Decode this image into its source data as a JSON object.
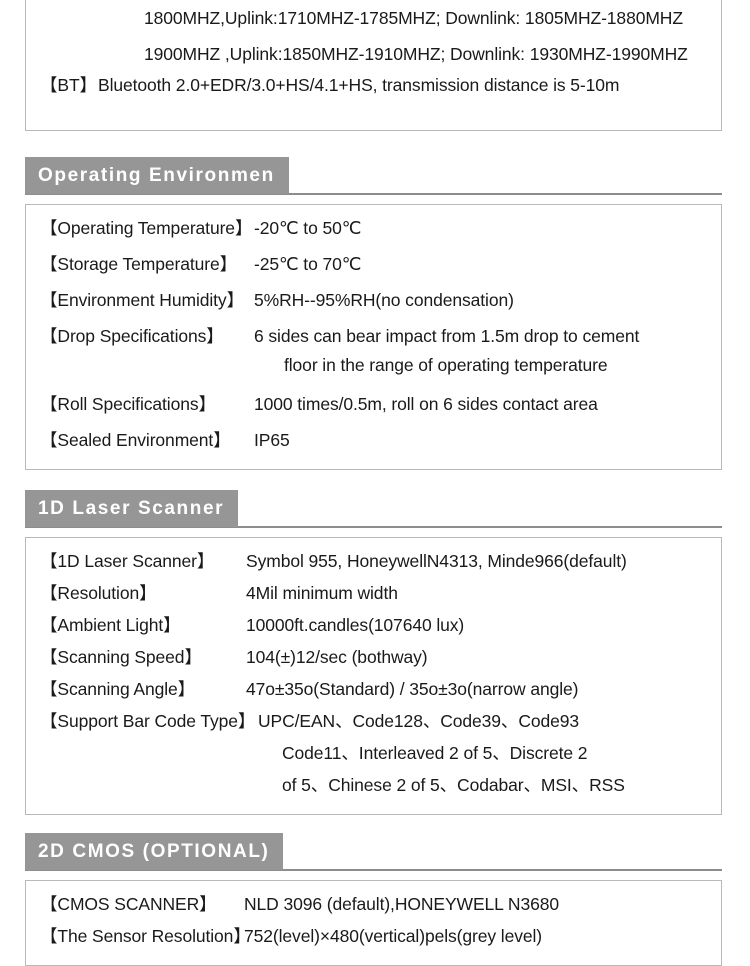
{
  "top_fragment": {
    "lines": [
      "1800MHZ,Uplink:1710MHZ-1785MHZ;  Downlink: 1805MHZ-1880MHZ",
      "1900MHZ ,Uplink:1850MHZ-1910MHZ;  Downlink: 1930MHZ-1990MHZ"
    ],
    "bt_label": "【BT】",
    "bt_value": "Bluetooth 2.0+EDR/3.0+HS/4.1+HS, transmission distance is 5-10m"
  },
  "sections": [
    {
      "title": "Operating Environmen",
      "rows": [
        {
          "label": "【Operating Temperature】",
          "value": "-20℃ to 50℃"
        },
        {
          "label": "【Storage Temperature】",
          "value": "-25℃ to 70℃"
        },
        {
          "label": "【Environment Humidity】",
          "value": "5%RH--95%RH(no condensation)"
        },
        {
          "label": "【Drop Specifications】",
          "value": "6 sides can bear impact from 1.5m drop to cement"
        },
        {
          "label": "",
          "value": "floor in the range of operating temperature"
        },
        {
          "label": "【Roll Specifications】",
          "value": "1000 times/0.5m, roll on 6 sides contact area"
        },
        {
          "label": "【Sealed Environment】",
          "value": "IP65"
        }
      ]
    },
    {
      "title": "1D Laser Scanner",
      "rows": [
        {
          "label": "【1D Laser Scanner】",
          "value": "Symbol 955, HoneywellN4313, Minde966(default)"
        },
        {
          "label": "【Resolution】",
          "value": "4Mil minimum width"
        },
        {
          "label": "【Ambient Light】",
          "value": "10000ft.candles(107640 lux)"
        },
        {
          "label": "【Scanning Speed】",
          "value": "104(±)12/sec (bothway)"
        },
        {
          "label": "【Scanning Angle】",
          "value": "47o±35o(Standard) / 35o±3o(narrow angle)"
        },
        {
          "label": "【Support Bar Code Type】",
          "value": "UPC/EAN、Code128、Code39、Code93"
        },
        {
          "label": "",
          "value": "Code11、Interleaved 2 of 5、Discrete 2"
        },
        {
          "label": "",
          "value": "of 5、Chinese 2 of 5、Codabar、MSI、RSS"
        }
      ]
    },
    {
      "title": "2D CMOS (OPTIONAL)",
      "rows": [
        {
          "label": "【CMOS SCANNER】",
          "value": "NLD 3096 (default),HONEYWELL N3680"
        },
        {
          "label": "【The Sensor  Resolution】",
          "value": "752(level)×480(vertical)pels(grey level)"
        }
      ]
    }
  ],
  "colors": {
    "header_gray": "#969696",
    "rule_gray": "#8d8d8d",
    "box_border": "#b9b9b9",
    "text": "#1a1a1a",
    "header_text": "#ffffff"
  }
}
